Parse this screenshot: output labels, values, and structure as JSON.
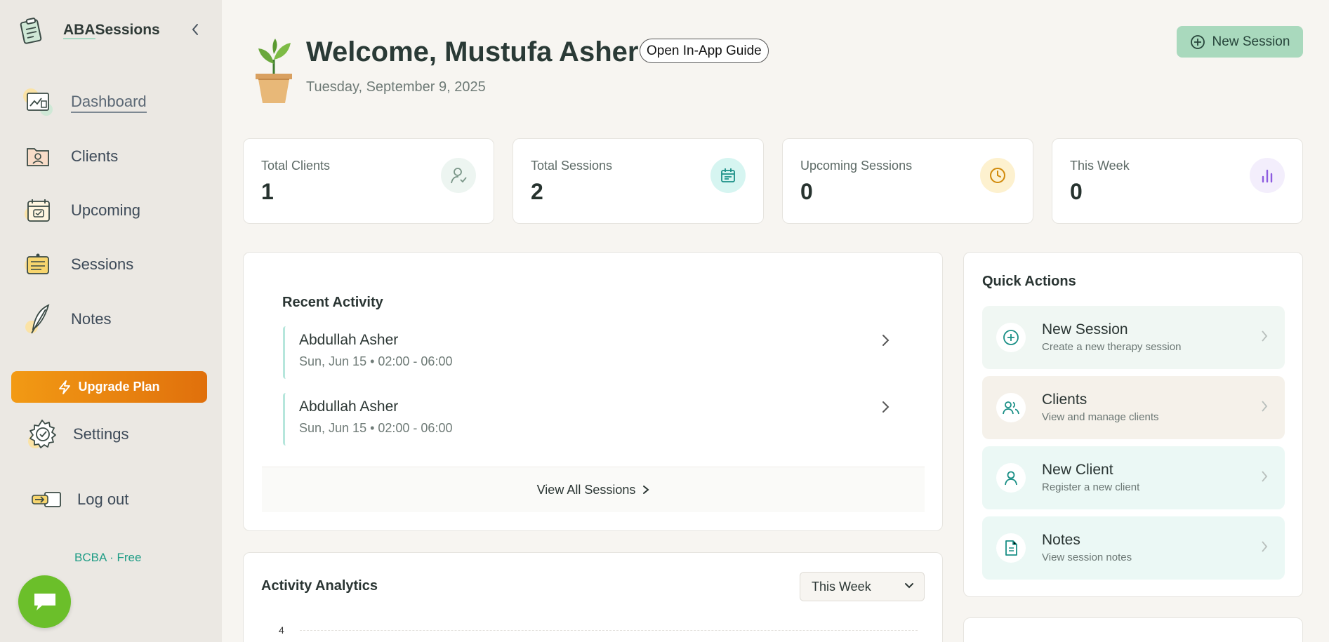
{
  "app": {
    "brand_prefix": "ABA",
    "brand_suffix": "Sessions"
  },
  "sidebar": {
    "items": [
      {
        "label": "Dashboard",
        "icon": "dashboard-icon",
        "active": true
      },
      {
        "label": "Clients",
        "icon": "clients-folder-icon"
      },
      {
        "label": "Upcoming",
        "icon": "calendar-icon"
      },
      {
        "label": "Sessions",
        "icon": "sessions-board-icon"
      },
      {
        "label": "Notes",
        "icon": "quill-icon"
      }
    ],
    "upgrade_label": "Upgrade Plan",
    "settings_label": "Settings",
    "logout_label": "Log out",
    "plan": "BCBA · Free"
  },
  "header": {
    "welcome": "Welcome, Mustufa Asher",
    "guide_label": "Open In-App Guide",
    "date": "Tuesday, September 9, 2025",
    "new_session_label": "New Session"
  },
  "stats": [
    {
      "title": "Total Clients",
      "value": "1",
      "icon": "user-icon",
      "color": "#7a9688",
      "bg": "#edf5f1"
    },
    {
      "title": "Total Sessions",
      "value": "2",
      "icon": "calendar-list-icon",
      "color": "#1a8f86",
      "bg": "#d6f5f1"
    },
    {
      "title": "Upcoming Sessions",
      "value": "0",
      "icon": "clock-icon",
      "color": "#d18a0a",
      "bg": "#fdf1cf"
    },
    {
      "title": "This Week",
      "value": "0",
      "icon": "bar-chart-icon",
      "color": "#8d5be0",
      "bg": "#f3eefc"
    }
  ],
  "recent": {
    "title": "Recent Activity",
    "items": [
      {
        "name": "Abdullah Asher",
        "time": "Sun, Jun 15 • 02:00 - 06:00"
      },
      {
        "name": "Abdullah Asher",
        "time": "Sun, Jun 15 • 02:00 - 06:00"
      }
    ],
    "view_all": "View All Sessions"
  },
  "analytics": {
    "title": "Activity Analytics",
    "range": "This Week",
    "y_tick": "4"
  },
  "quick_actions": {
    "title": "Quick Actions",
    "items": [
      {
        "label": "New Session",
        "desc": "Create a new therapy session",
        "icon": "plus-circle-icon",
        "bg": "#f0f7f3"
      },
      {
        "label": "Clients",
        "desc": "View and manage clients",
        "icon": "users-icon",
        "bg": "#f5f1ea"
      },
      {
        "label": "New Client",
        "desc": "Register a new client",
        "icon": "user-add-icon",
        "bg": "#ebf8f5"
      },
      {
        "label": "Notes",
        "desc": "View session notes",
        "icon": "document-icon",
        "bg": "#ebf8f5"
      }
    ]
  }
}
